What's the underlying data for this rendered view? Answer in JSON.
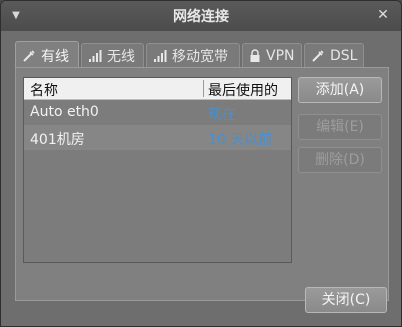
{
  "window": {
    "title": "网络连接",
    "menu_icon": "chevron-down-icon",
    "close_icon": "close-icon"
  },
  "tabs": [
    {
      "label": "有线",
      "icon": "wired-icon",
      "active": true
    },
    {
      "label": "无线",
      "icon": "signal-icon",
      "active": false
    },
    {
      "label": "移动宽带",
      "icon": "signal-icon",
      "active": false
    },
    {
      "label": "VPN",
      "icon": "lock-icon",
      "active": false
    },
    {
      "label": "DSL",
      "icon": "wired-icon",
      "active": false
    }
  ],
  "table": {
    "columns": [
      "名称",
      "最后使用的"
    ],
    "rows": [
      {
        "name": "Auto eth0",
        "last_used": "现在"
      },
      {
        "name": "401机房",
        "last_used": "10 天以前"
      }
    ]
  },
  "buttons": {
    "add": "添加(A)",
    "edit": "编辑(E)",
    "delete": "删除(D)",
    "close": "关闭(C)"
  },
  "colors": {
    "link_blue": "#4a8fcf",
    "header_bg": "#f0f0f0"
  }
}
